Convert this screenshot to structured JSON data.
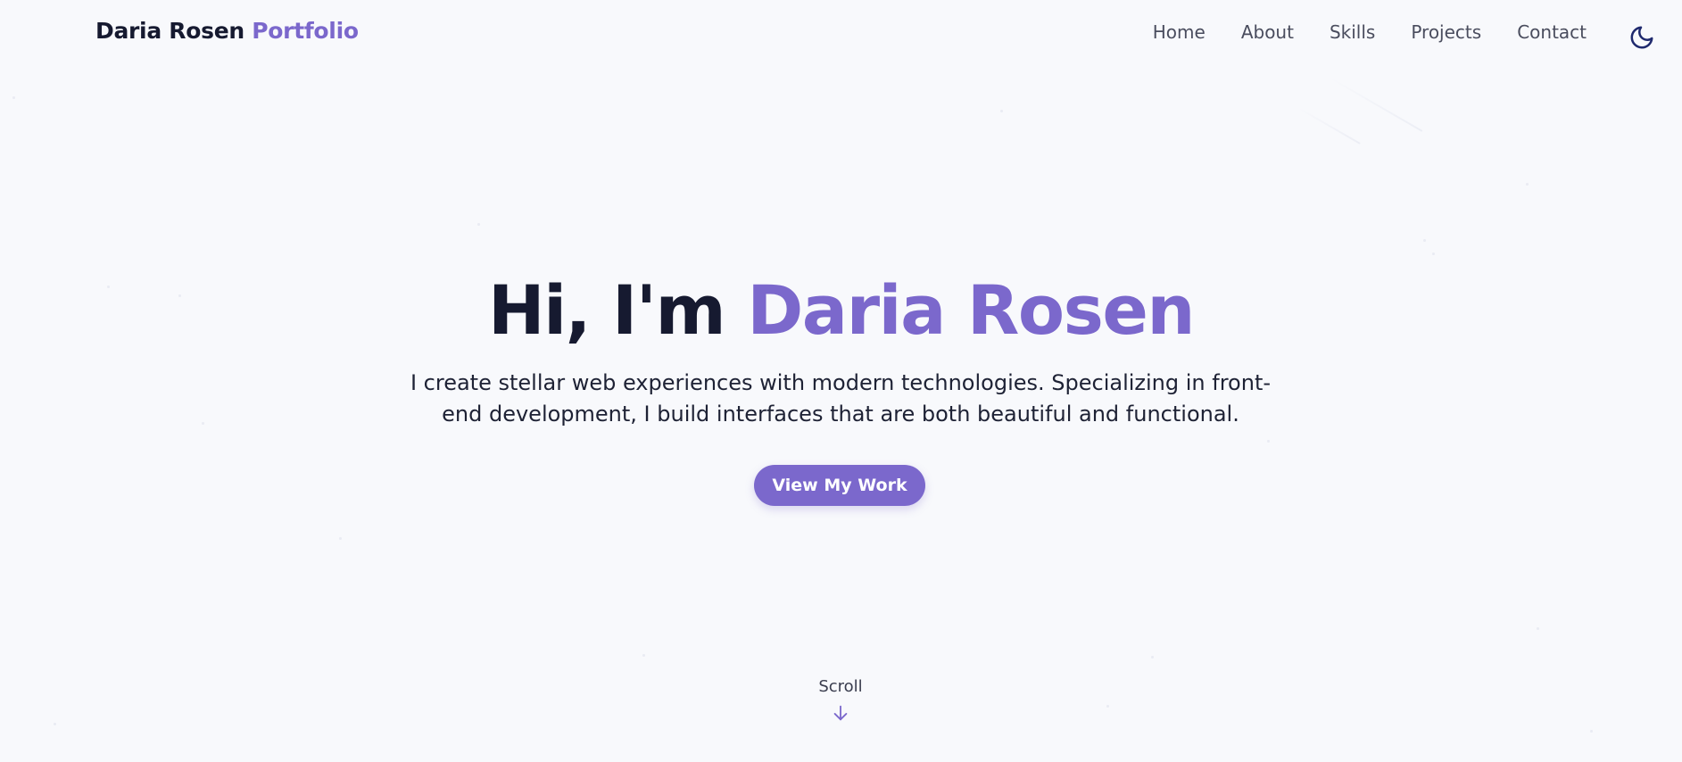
{
  "brand": {
    "name": "Daria Rosen",
    "accent": "Portfolio"
  },
  "nav": {
    "items": [
      {
        "label": "Home"
      },
      {
        "label": "About"
      },
      {
        "label": "Skills"
      },
      {
        "label": "Projects"
      },
      {
        "label": "Contact"
      }
    ],
    "theme_toggle_icon": "moon-icon"
  },
  "hero": {
    "greeting": "Hi, I'm",
    "name": "Daria Rosen",
    "subtitle": "I create stellar web experiences with modern technologies. Specializing in front-end development, I build interfaces that are both beautiful and functional.",
    "cta_label": "View My Work"
  },
  "scroll": {
    "label": "Scroll",
    "icon": "arrow-down-icon"
  },
  "colors": {
    "accent": "#7b68cc",
    "text_dark": "#161a30",
    "background": "#f8f9fc"
  }
}
